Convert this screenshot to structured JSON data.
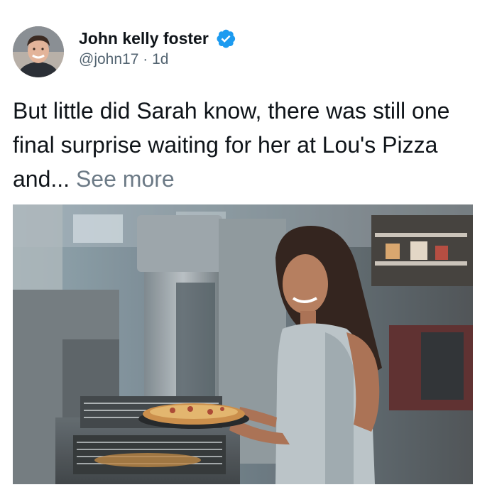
{
  "tweet": {
    "author": {
      "display_name": "John kelly foster",
      "verified": true,
      "handle": "@john17",
      "separator": "·",
      "time_ago": "1d"
    },
    "text": "But little did Sarah know, there was still one final surprise waiting for her at Lou's Pizza and...",
    "see_more_label": "See more",
    "colors": {
      "verified_badge": "#1d9bf0",
      "name": "#0f1419",
      "secondary": "#536471",
      "see_more": "#6c7a86"
    },
    "media": {
      "icon": "photo-woman-serving-pizza-in-kitchen"
    }
  }
}
